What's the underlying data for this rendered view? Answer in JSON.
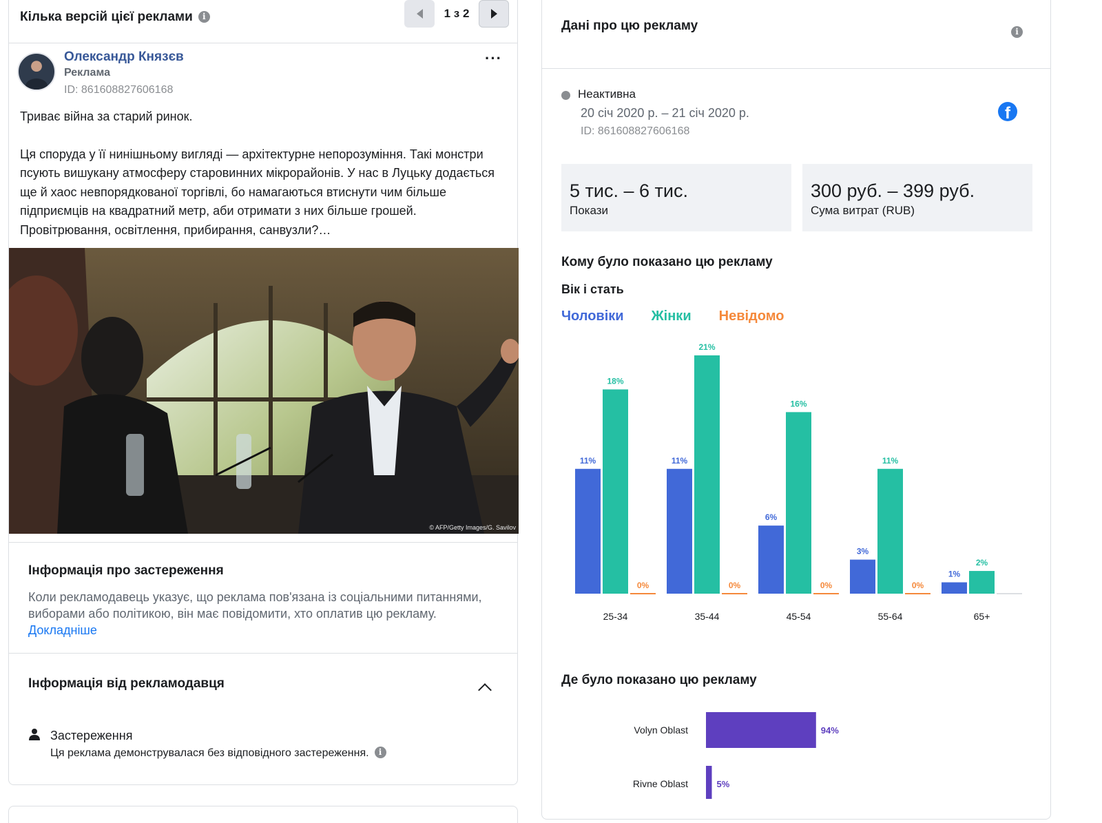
{
  "left": {
    "versions_title": "Кілька версій цієї реклами",
    "pager_text": "1 з 2",
    "advertiser_name": "Олександр Князєв",
    "advertiser_sub": "Реклама",
    "ad_id": "ID: 861608827606168",
    "ad_text_1": "Триває війна за старий ринок.",
    "ad_text_2": "Ця споруда у її нинішньому вигляді — архітектурне непорозуміння. Такі монстри псують вишукану атмосферу старовинних мікрорайонів. У нас в Луцьку додається ще й хаос невпорядкованої торгівлі, бо намагаються втиснути чим більше підприємців на квадратний метр, аби отримати з них більше грошей. Провітрювання, освітлення, прибирання, санвузли?…",
    "photo_credit": "© AFP/Getty Images/G. Savilov",
    "disclaimer_title": "Інформація про застереження",
    "disclaimer_text": "Коли рекламодавець указує, що реклама пов'язана із соціальними питаннями, виборами або політикою, він має повідомити, хто оплатив цю рекламу.",
    "learn_more": "Докладніше",
    "advertiser_info_title": "Інформація від рекламодавця",
    "disclaimer_item_title": "Застереження",
    "disclaimer_item_text": "Ця реклама демонструвалася без відповідного застереження."
  },
  "right": {
    "title": "Дані про цю рекламу",
    "status": "Неактивна",
    "dates": "20 січ 2020 р. – 21 січ 2020 р.",
    "ad_id": "ID: 861608827606168",
    "impressions_value": "5 тис. – 6 тис.",
    "impressions_label": "Покази",
    "spend_value": "300 руб. – 399 руб.",
    "spend_label": "Сума витрат (RUB)",
    "audience_title": "Кому було показано цю рекламу",
    "age_gender_title": "Вік і стать",
    "location_title": "Де було показано цю рекламу"
  },
  "colors": {
    "men": "#4169d8",
    "women": "#25bfa3",
    "unknown": "#f5893b",
    "region": "#5e3fbf"
  },
  "chart_data": [
    {
      "type": "bar",
      "categories": [
        "25-34",
        "35-44",
        "45-54",
        "55-64",
        "65+"
      ],
      "series": [
        {
          "name": "Чоловіки",
          "values": [
            11,
            11,
            6,
            3,
            1
          ]
        },
        {
          "name": "Жінки",
          "values": [
            18,
            21,
            16,
            11,
            2
          ]
        },
        {
          "name": "Невідомо",
          "values": [
            0,
            0,
            0,
            0,
            null
          ]
        }
      ],
      "value_suffix": "%",
      "ylim": [
        0,
        21
      ],
      "legend": "top-left",
      "grid": false
    },
    {
      "type": "bar",
      "orientation": "horizontal",
      "categories": [
        "Volyn Oblast",
        "Rivne Oblast"
      ],
      "values": [
        94,
        5
      ],
      "value_suffix": "%",
      "xlim": [
        0,
        100
      ]
    }
  ]
}
